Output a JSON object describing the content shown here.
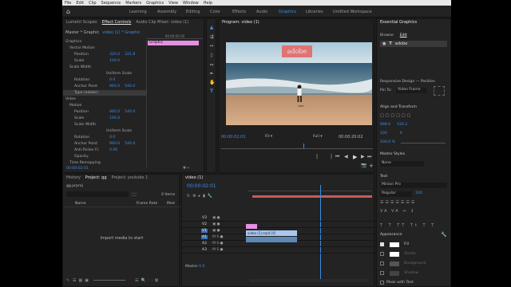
{
  "menu": [
    "File",
    "Edit",
    "Clip",
    "Sequence",
    "Markers",
    "Graphics",
    "View",
    "Window",
    "Help"
  ],
  "workspaces": [
    "Learning",
    "Assembly",
    "Editing",
    "Color",
    "Effects",
    "Audio",
    "Graphics",
    "Libraries",
    "Untitled Workspace"
  ],
  "top_left_panel": {
    "tabs": [
      "Lumetri Scopes",
      "Effect Controls",
      "Audio Clip Mixer: video (1)"
    ],
    "breadcrumb": "Master * Graphic",
    "clip_dropdown": "video (1) * Graphic",
    "timecode_right": "00:00:05:00",
    "graphic_label": "Graphic",
    "rows": [
      {
        "label": "Graphics"
      },
      {
        "label": "Vector Motion"
      },
      {
        "label": "Position",
        "value": "320.0",
        "value2": "321.8"
      },
      {
        "label": "Scale",
        "value": "109.0"
      },
      {
        "label": "Scale Width"
      },
      {
        "label": "",
        "check": "Uniform Scale"
      },
      {
        "label": "Rotation",
        "value": "0.0"
      },
      {
        "label": "Anchor Point",
        "value": "960.0",
        "value2": "540.0"
      },
      {
        "label": "Type (adobe)"
      },
      {
        "label": "Video"
      },
      {
        "label": "Motion"
      },
      {
        "label": "Position",
        "value": "960.0",
        "value2": "540.0"
      },
      {
        "label": "Scale",
        "value": "100.0"
      },
      {
        "label": "Scale Width"
      },
      {
        "label": "",
        "check": "Uniform Scale"
      },
      {
        "label": "Rotation",
        "value": "0.0"
      },
      {
        "label": "Anchor Point",
        "value": "960.0",
        "value2": "540.0"
      },
      {
        "label": "Anti-flicker Fi.",
        "value": "0.00"
      },
      {
        "label": "Opacity"
      },
      {
        "label": "Time Remapping"
      }
    ],
    "bottom_timecode": "00:00:02:01"
  },
  "program": {
    "title": "Program: video (1)",
    "overlay_text": "adobe",
    "timecode_left": "00:00:02:01",
    "fit": "Fit",
    "quality": "Full",
    "timecode_right": "00:00:20:02"
  },
  "essential_graphics": {
    "title": "Essential Graphics",
    "tabs": [
      "Browse",
      "Edit"
    ],
    "layer_name": "adobe",
    "responsive_design_position": "Responsive Design — Position",
    "pin_to_label": "Pin To:",
    "pin_to_value": "Video Frame",
    "align_transform": "Align and Transform",
    "pos_x": "898.6",
    "pos_y": "526.2",
    "rotation": "0",
    "scale": "100",
    "opacity": "100.0 %",
    "master_styles": "Master Styles",
    "master_style_value": "None",
    "text": "Text",
    "font": "Minion Pro",
    "font_style": "Regular",
    "font_size": "100",
    "appearance": "Appearance",
    "fill": "Fill",
    "stroke": "Stroke",
    "background": "Background",
    "shadow": "Shadow",
    "mask_with_text": "Mask with Text"
  },
  "project": {
    "tabs": [
      "History",
      "Project: gg",
      "Project: youtube 1"
    ],
    "project_file": "gg.prproj",
    "items_count": "0 Items",
    "col_name": "Name",
    "col_frame_rate": "Frame Rate",
    "col_media": "Med",
    "import_hint": "Import media to start"
  },
  "timeline": {
    "tab": "video (1)",
    "timecode": "00:00:02:01",
    "tracks": [
      "V3",
      "V2",
      "V1",
      "A1",
      "A2",
      "A3"
    ],
    "clip_label": "video (1).mp4 [V]",
    "master_label": "Master",
    "master_value": "0.0"
  },
  "colors": {
    "accent": "#3c8de5",
    "clip_pink": "#e58ee5",
    "clip_blue": "#a9c7ef"
  }
}
